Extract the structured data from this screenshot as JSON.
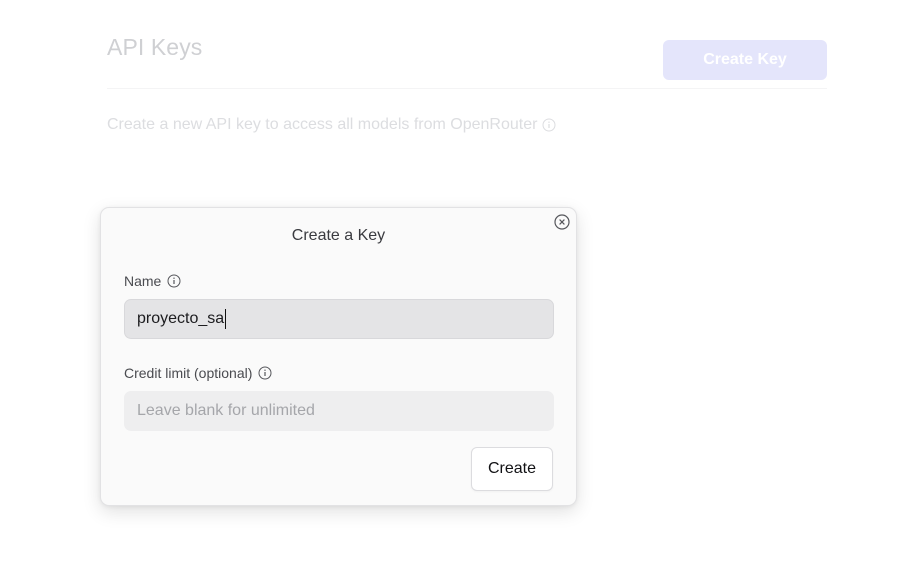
{
  "page": {
    "title": "API Keys",
    "create_key_label": "Create Key",
    "description": "Create a new API key to access all models from OpenRouter",
    "description_icon": "info-icon"
  },
  "modal": {
    "title": "Create a Key",
    "close_icon": "close-circle-icon",
    "name": {
      "label": "Name",
      "icon": "info-icon",
      "value": "proyecto_sa"
    },
    "credit_limit": {
      "label": "Credit limit (optional)",
      "icon": "info-icon",
      "value": "",
      "placeholder": "Leave blank for unlimited"
    },
    "create_label": "Create"
  },
  "colors": {
    "accent_disabled": "#e4e5fb",
    "faded_text": "#cfd0d3",
    "modal_bg": "#fafafa"
  }
}
